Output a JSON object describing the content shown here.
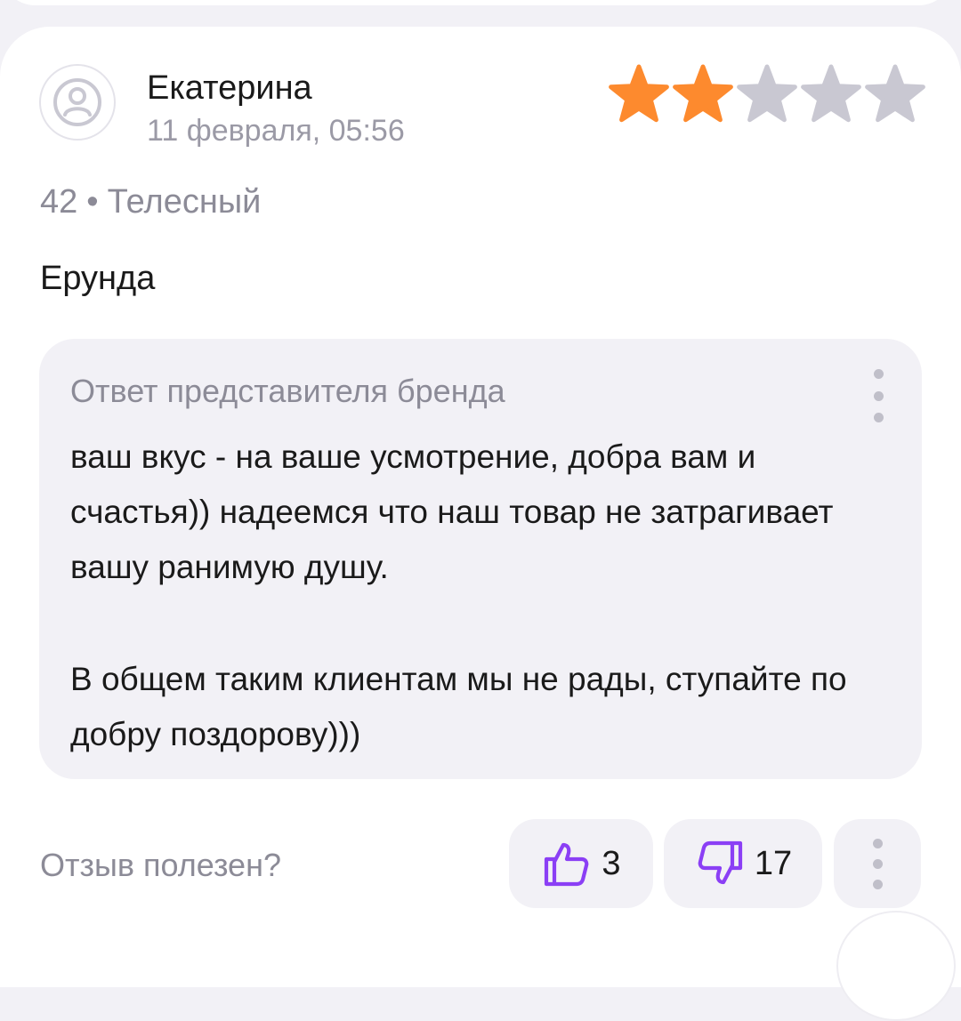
{
  "review": {
    "author": "Екатерина",
    "date": "11 февраля, 05:56",
    "rating": 2,
    "rating_max": 5,
    "size": "42",
    "separator": "•",
    "color": "Телесный",
    "text": "Ерунда"
  },
  "reply": {
    "title": "Ответ представителя бренда",
    "paragraph1": "ваш вкус - на ваше усмотрение, добра вам и счастья)) надеемся что наш товар не затрагивает вашу ранимую душу.",
    "paragraph2": "В общем таким клиентам мы не рады, ступайте по добру поздорову)))"
  },
  "feedback": {
    "label": "Отзыв полезен?",
    "likes": "3",
    "dislikes": "17"
  },
  "icons": {
    "avatar": "user-avatar-icon",
    "star": "star-icon",
    "like": "thumbs-up-icon",
    "dislike": "thumbs-down-icon",
    "more": "more-vertical-icon"
  },
  "colors": {
    "star_filled": "#fd8a2e",
    "star_empty": "#c9c8d2",
    "accent": "#8b3ff5",
    "muted_text": "#8c8b97",
    "panel": "#f2f1f6"
  }
}
